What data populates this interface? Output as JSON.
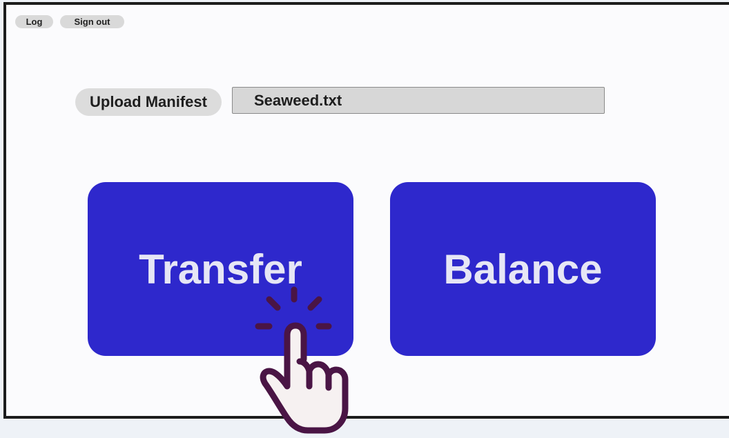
{
  "topbar": {
    "log_label": "Log",
    "signout_label": "Sign out"
  },
  "manifest": {
    "upload_label": "Upload Manifest",
    "file_name": "Seaweed.txt"
  },
  "actions": {
    "transfer_label": "Transfer",
    "balance_label": "Balance"
  },
  "colors": {
    "primary_button": "#2e28cc",
    "button_text": "#e6e6f5",
    "cursor_outline": "#4a1545"
  },
  "icons": {
    "cursor": "hand-tap-icon"
  }
}
